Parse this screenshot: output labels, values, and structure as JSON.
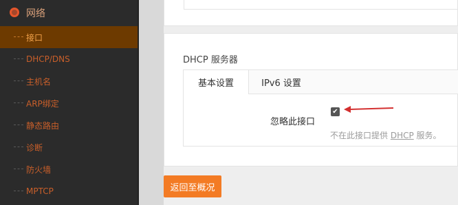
{
  "sidebar": {
    "section_title": "网络",
    "items": [
      {
        "label": "接口",
        "active": true
      },
      {
        "label": "DHCP/DNS"
      },
      {
        "label": "主机名"
      },
      {
        "label": "ARP绑定"
      },
      {
        "label": "静态路由"
      },
      {
        "label": "诊断"
      },
      {
        "label": "防火墙"
      },
      {
        "label": "MPTCP"
      }
    ]
  },
  "dhcp": {
    "title": "DHCP 服务器",
    "tabs": {
      "basic": "基本设置",
      "ipv6": "IPv6 设置"
    },
    "ignore_interface": {
      "label": "忽略此接口",
      "checked": true,
      "help_prefix": "不在此接口提供 ",
      "help_link": "DHCP",
      "help_suffix": " 服务。"
    }
  },
  "actions": {
    "back_label": "返回至概况"
  },
  "colors": {
    "accent": "#f37b24",
    "sidebar_bg": "#2b2b2b",
    "sidebar_active_bg": "#6d3a00",
    "annotation_arrow": "#d32f2f"
  }
}
